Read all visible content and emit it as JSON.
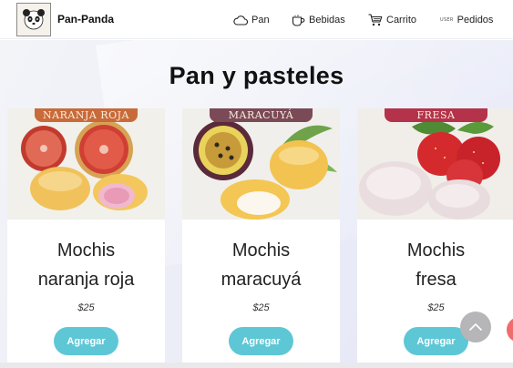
{
  "header": {
    "brand": "Pan-Panda",
    "nav": [
      {
        "label": "Pan",
        "icon": "cloud-icon"
      },
      {
        "label": "Bebidas",
        "icon": "cup-icon"
      },
      {
        "label": "Carrito",
        "icon": "cart-icon"
      },
      {
        "label": "Pedidos",
        "icon": "user-badge-icon",
        "icon_text": "USER"
      }
    ]
  },
  "main": {
    "title": "Pan y pasteles",
    "products": [
      {
        "ribbon": "NARANJA ROJA",
        "name_line1": "Mochis",
        "name_line2": "naranja roja",
        "price": "$25",
        "button": "Agregar",
        "ribbon_color": "#c96a3a"
      },
      {
        "ribbon": "MARACUYÁ",
        "name_line1": "Mochis",
        "name_line2": "maracuyá",
        "price": "$25",
        "button": "Agregar",
        "ribbon_color": "#7b4a57"
      },
      {
        "ribbon": "FRESA",
        "name_line1": "Mochis",
        "name_line2": "fresa",
        "price": "$25",
        "button": "Agregar",
        "ribbon_color": "#b4334a"
      }
    ]
  },
  "colors": {
    "button": "#5ec7d6",
    "scroll_button": "#b6b6b9",
    "accent_red": "#ef6c6c"
  }
}
